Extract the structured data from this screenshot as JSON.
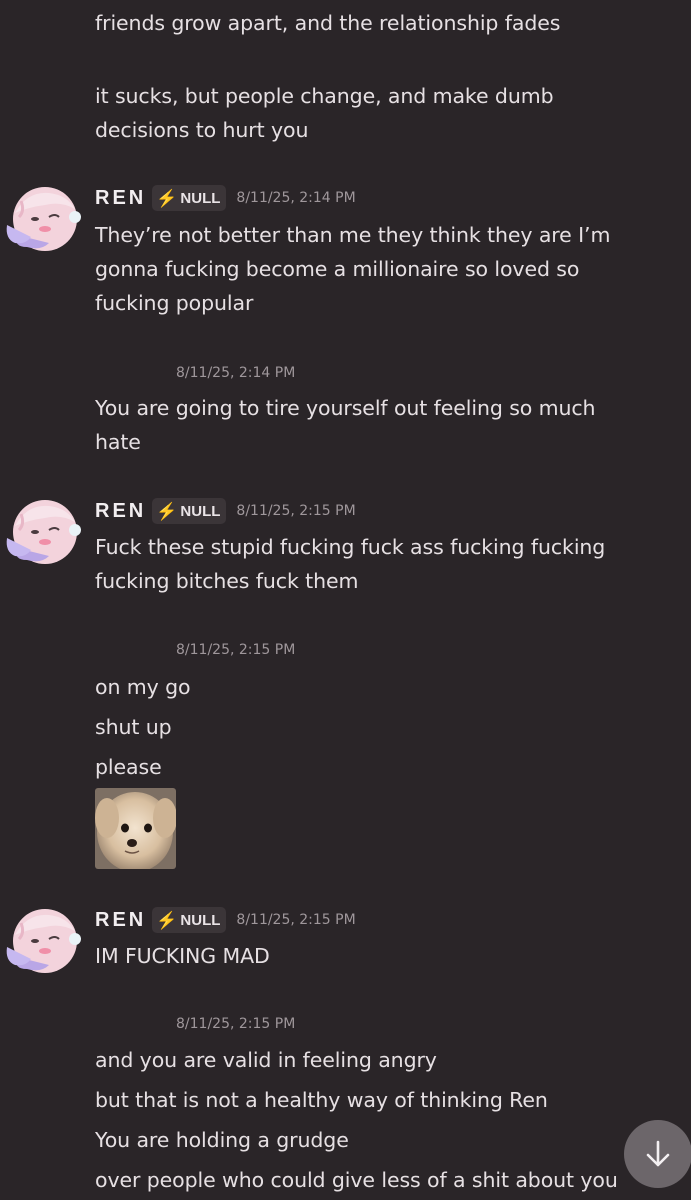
{
  "messages": {
    "m0": {
      "lines": [
        "friends grow apart, and the relationship fades",
        "it sucks, but people change, and make dumb",
        "decisions to hurt you"
      ]
    },
    "m1": {
      "username": "REN",
      "role": "NULL",
      "timestamp": "8/11/25, 2:14 PM",
      "lines": [
        "They’re not better than me they think they are I’m",
        "gonna fucking become a millionaire so loved so",
        "fucking popular"
      ]
    },
    "m2": {
      "timestamp": "8/11/25, 2:14 PM",
      "lines": [
        "You are going to tire yourself out feeling so much",
        "hate"
      ]
    },
    "m3": {
      "username": "REN",
      "role": "NULL",
      "timestamp": "8/11/25, 2:15 PM",
      "lines": [
        "Fuck these stupid fucking fuck ass fucking fucking",
        "fucking bitches fuck them"
      ]
    },
    "m4": {
      "timestamp": "8/11/25, 2:15 PM",
      "lines": [
        "on my go",
        "shut up",
        "please"
      ]
    },
    "m5": {
      "username": "REN",
      "role": "NULL",
      "timestamp": "8/11/25, 2:15 PM",
      "lines": [
        "IM FUCKING MAD"
      ]
    },
    "m6": {
      "timestamp": "8/11/25, 2:15 PM",
      "lines": [
        "and you are valid in feeling angry",
        "but that is not a healthy way of thinking Ren",
        "You are holding a grudge",
        "over people who could give less of a shit about you"
      ]
    }
  },
  "icons": {
    "role": "lightning-bolt-icon",
    "scroll": "arrow-down-icon",
    "avatar": "anime-character-avatar",
    "attachment": "dog-photo"
  },
  "colors": {
    "background": "#2a2528",
    "text": "#e6e0e3",
    "timestamp": "#9f979b",
    "role_bolt": "#e8445a",
    "role_tag_bg": "#3b3538"
  }
}
